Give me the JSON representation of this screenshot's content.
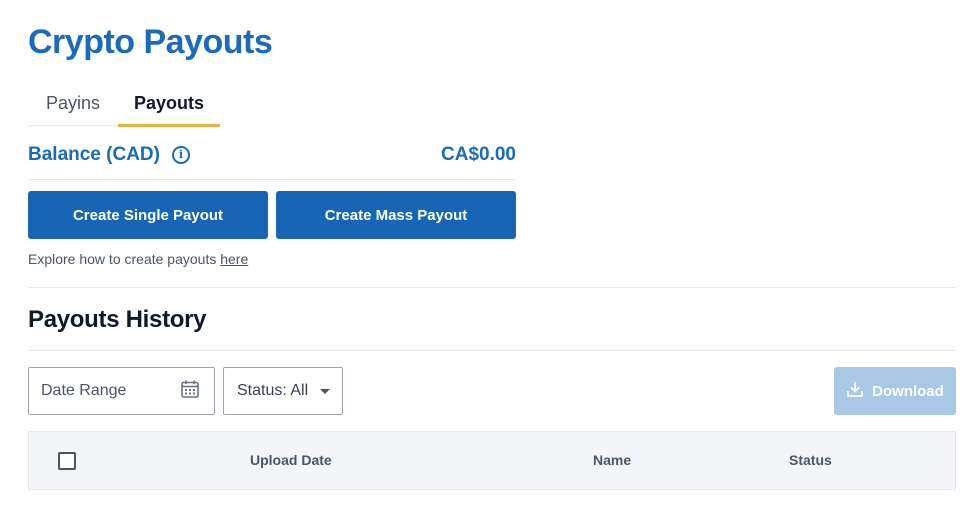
{
  "page": {
    "title": "Crypto Payouts"
  },
  "tabs": [
    {
      "label": "Payins",
      "active": false
    },
    {
      "label": "Payouts",
      "active": true
    }
  ],
  "balance": {
    "label": "Balance (CAD)",
    "info_icon": "info-icon",
    "value": "CA$0.00"
  },
  "actions": {
    "single_payout_label": "Create Single Payout",
    "mass_payout_label": "Create Mass Payout"
  },
  "explore": {
    "text": "Explore how to create payouts ",
    "link_text": "here"
  },
  "history": {
    "title": "Payouts History",
    "date_range_placeholder": "Date Range",
    "date_range_icon": "calendar-icon",
    "status_filter_label": "Status: All",
    "status_filter_icon": "chevron-down-icon",
    "download_label": "Download",
    "download_icon": "download-icon",
    "columns": [
      "Upload Date",
      "Name",
      "Status"
    ]
  },
  "colors": {
    "brand_blue": "#1a6bbd",
    "button_blue": "#1766b5",
    "tab_underline": "#e8b33a",
    "download_disabled": "#a9c8e8",
    "table_header_bg": "#f3f5f8"
  }
}
